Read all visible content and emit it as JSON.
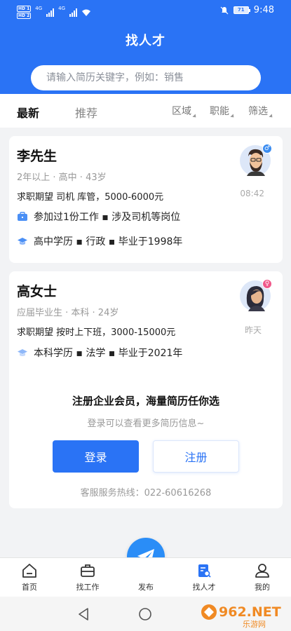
{
  "status_bar": {
    "hd1": "HD 1",
    "hd2": "HD 2",
    "net1": "4G",
    "net2": "4G",
    "battery": "71",
    "time": "9:48"
  },
  "header": {
    "title": "找人才",
    "search_placeholder": "请输入简历关键字，例如：销售"
  },
  "tabs": {
    "latest": "最新",
    "recommended": "推荐"
  },
  "filters": [
    "区域",
    "职能",
    "筛选"
  ],
  "candidates": [
    {
      "name": "李先生",
      "meta": "2年以上 · 高中 · 43岁",
      "expect": "求职期望 司机 库管，5000-6000元",
      "experience": "参加过1份工作 ▪ 涉及司机等岗位",
      "education": "高中学历 ▪ 行政 ▪ 毕业于1998年",
      "time": "08:42",
      "gender_icon": "male-icon",
      "gender_color": "#3b8cf0"
    },
    {
      "name": "高女士",
      "meta": "应届毕业生 · 本科 · 24岁",
      "expect": "求职期望 按时上下班，3000-15000元",
      "education": "本科学历 ▪ 法学 ▪ 毕业于2021年",
      "time": "昨天",
      "gender_icon": "female-icon",
      "gender_color": "#f0588a"
    }
  ],
  "promo": {
    "title": "注册企业会员，海量简历任你选",
    "subtitle": "登录可以查看更多简历信息~",
    "login": "登录",
    "register": "注册",
    "hotline": "客服服务热线：022-60616268"
  },
  "bottom_nav": {
    "home": "首页",
    "jobs": "找工作",
    "publish": "发布",
    "talent": "找人才",
    "mine": "我的"
  },
  "watermark": {
    "logo": "962.NET",
    "caption": "乐游网"
  },
  "colors": {
    "primary": "#2a73f5",
    "background": "#f2f3f5"
  }
}
